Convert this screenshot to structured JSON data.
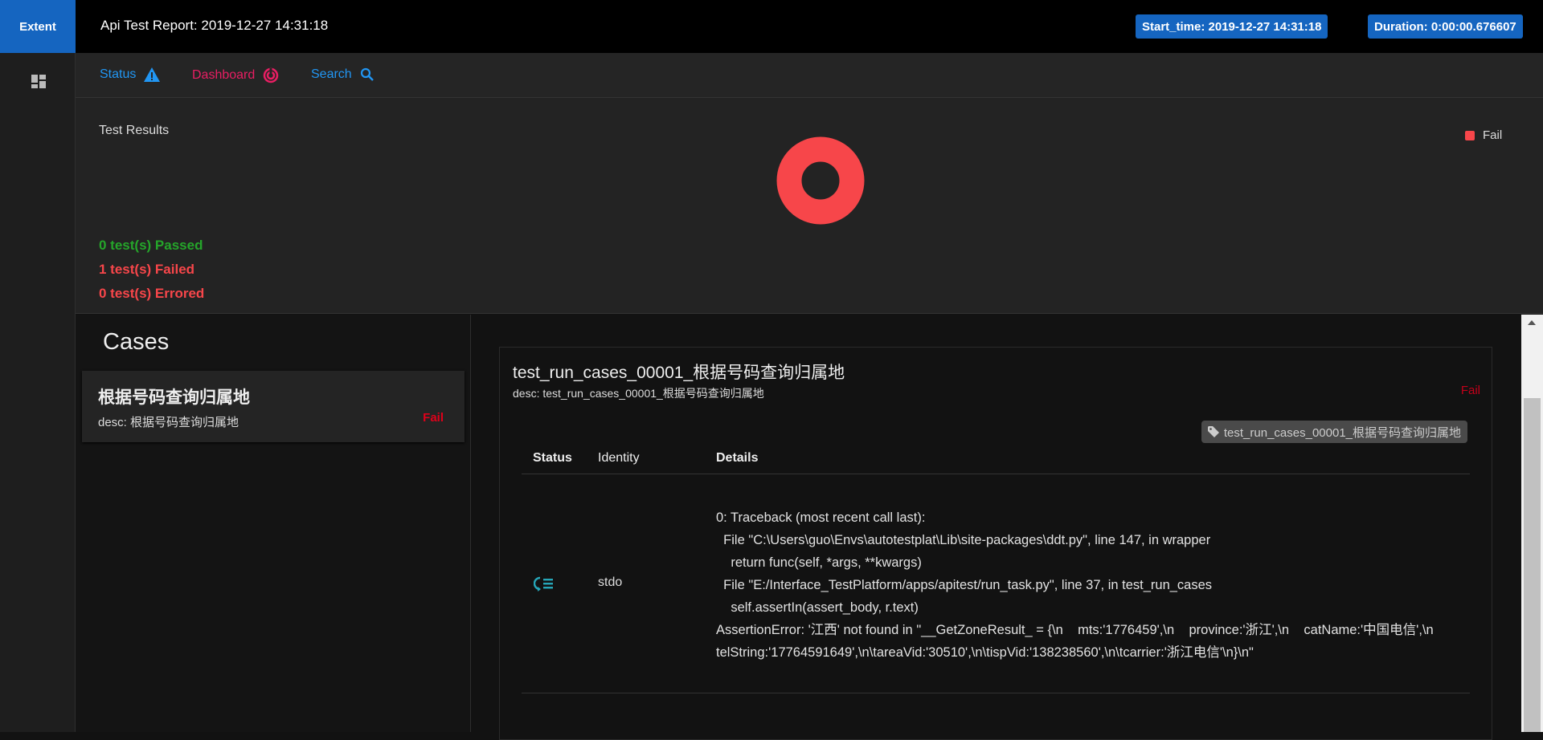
{
  "header": {
    "brand": "Extent",
    "title": "Api Test Report: 2019-12-27 14:31:18",
    "start_time": "Start_time: 2019-12-27 14:31:18",
    "duration": "Duration: 0:00:00.676607"
  },
  "nav": {
    "status": "Status",
    "dashboard": "Dashboard",
    "search": "Search"
  },
  "results": {
    "title": "Test Results",
    "legend": "Fail",
    "passed": "0 test(s) Passed",
    "failed": "1 test(s) Failed",
    "errored": "0 test(s) Errored",
    "chart": {
      "fail": 1,
      "pass": 0,
      "error": 0
    }
  },
  "colors": {
    "fail": "#f7464a",
    "passed": "#25a52a",
    "failed": "#f7464a",
    "accent": "#1565c0"
  },
  "cases": {
    "title": "Cases",
    "items": [
      {
        "name": "根据号码查询归属地",
        "desc": "desc: 根据号码查询归属地",
        "status": "Fail"
      }
    ]
  },
  "test": {
    "title": "test_run_cases_00001_根据号码查询归属地",
    "desc": "desc: test_run_cases_00001_根据号码查询归属地",
    "status": "Fail",
    "tag": "test_run_cases_00001_根据号码查询归属地",
    "columns": [
      "Status",
      "Identity",
      "Details"
    ],
    "rows": [
      {
        "identity": "stdo",
        "details": "0: Traceback (most recent call last):\n  File \"C:\\Users\\guo\\Envs\\autotestplat\\Lib\\site-packages\\ddt.py\", line 147, in wrapper\n    return func(self, *args, **kwargs)\n  File \"E:/Interface_TestPlatform/apps/apitest/run_task.py\", line 37, in test_run_cases\n    self.assertIn(assert_body, r.text)\nAssertionError: '江西' not found in \"__GetZoneResult_ = {\\n    mts:'1776459',\\n    province:'浙江',\\n    catName:'中国电信',\\n    telString:'17764591649',\\n\\tareaVid:'30510',\\n\\tispVid:'138238560',\\n\\tcarrier:'浙江电信'\\n}\\n\""
      }
    ]
  }
}
